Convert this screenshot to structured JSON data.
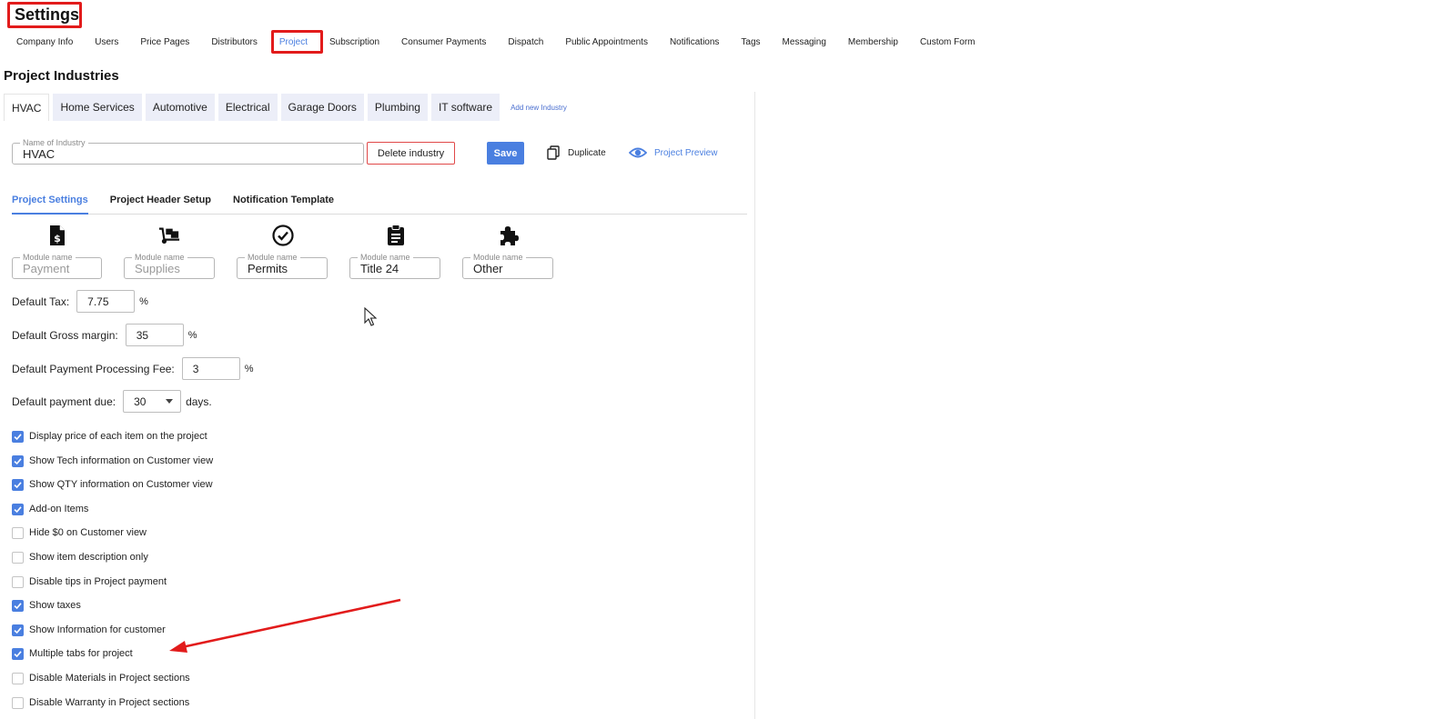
{
  "page": {
    "title": "Settings"
  },
  "top_nav": {
    "items": [
      "Company Info",
      "Users",
      "Price Pages",
      "Distributors",
      "Project",
      "Subscription",
      "Consumer Payments",
      "Dispatch",
      "Public Appointments",
      "Notifications",
      "Tags",
      "Messaging",
      "Membership",
      "Custom Form"
    ],
    "active": "Project"
  },
  "section": {
    "title": "Project Industries"
  },
  "industry_tabs": {
    "items": [
      "HVAC",
      "Home Services",
      "Automotive",
      "Electrical",
      "Garage Doors",
      "Plumbing",
      "IT software"
    ],
    "active": "HVAC",
    "add_label": "Add new Industry"
  },
  "industry_form": {
    "name_label": "Name of Industry",
    "name_value": "HVAC",
    "delete_label": "Delete industry",
    "save_label": "Save",
    "duplicate_label": "Duplicate",
    "preview_label": "Project Preview"
  },
  "sub_tabs": {
    "items": [
      "Project Settings",
      "Project Header Setup",
      "Notification Template"
    ],
    "active": "Project Settings"
  },
  "modules": [
    {
      "icon": "invoice-dollar-icon",
      "label": "Module name",
      "value": "Payment",
      "muted": true
    },
    {
      "icon": "dolly-icon",
      "label": "Module name",
      "value": "Supplies",
      "muted": true
    },
    {
      "icon": "check-circle-icon",
      "label": "Module name",
      "value": "Permits",
      "muted": false
    },
    {
      "icon": "clipboard-icon",
      "label": "Module name",
      "value": "Title 24",
      "muted": false
    },
    {
      "icon": "puzzle-icon",
      "label": "Module name",
      "value": "Other",
      "muted": false
    }
  ],
  "defaults": {
    "tax_label": "Default Tax:",
    "tax_value": "7.75",
    "gross_margin_label": "Default Gross margin:",
    "gross_margin_value": "35",
    "processing_fee_label": "Default Payment Processing Fee:",
    "processing_fee_value": "3",
    "percent_unit": "%",
    "payment_due_label": "Default payment due:",
    "payment_due_value": "30",
    "days_unit": "days."
  },
  "options": [
    {
      "label": "Display price of each item on the project",
      "checked": true
    },
    {
      "label": "Show Tech information on Customer view",
      "checked": true
    },
    {
      "label": "Show QTY information on Customer view",
      "checked": true
    },
    {
      "label": "Add-on Items",
      "checked": true
    },
    {
      "label": "Hide $0 on Customer view",
      "checked": false
    },
    {
      "label": "Show item description only",
      "checked": false
    },
    {
      "label": "Disable tips in Project payment",
      "checked": false
    },
    {
      "label": "Show taxes",
      "checked": true
    },
    {
      "label": "Show Information for customer",
      "checked": true
    },
    {
      "label": "Multiple tabs for project",
      "checked": true
    },
    {
      "label": "Disable Materials in Project sections",
      "checked": false
    },
    {
      "label": "Disable Warranty in Project sections",
      "checked": false
    }
  ],
  "colors": {
    "accent": "#4a7fe0",
    "annotation": "#e21b1b",
    "delete_border": "#e04848"
  }
}
